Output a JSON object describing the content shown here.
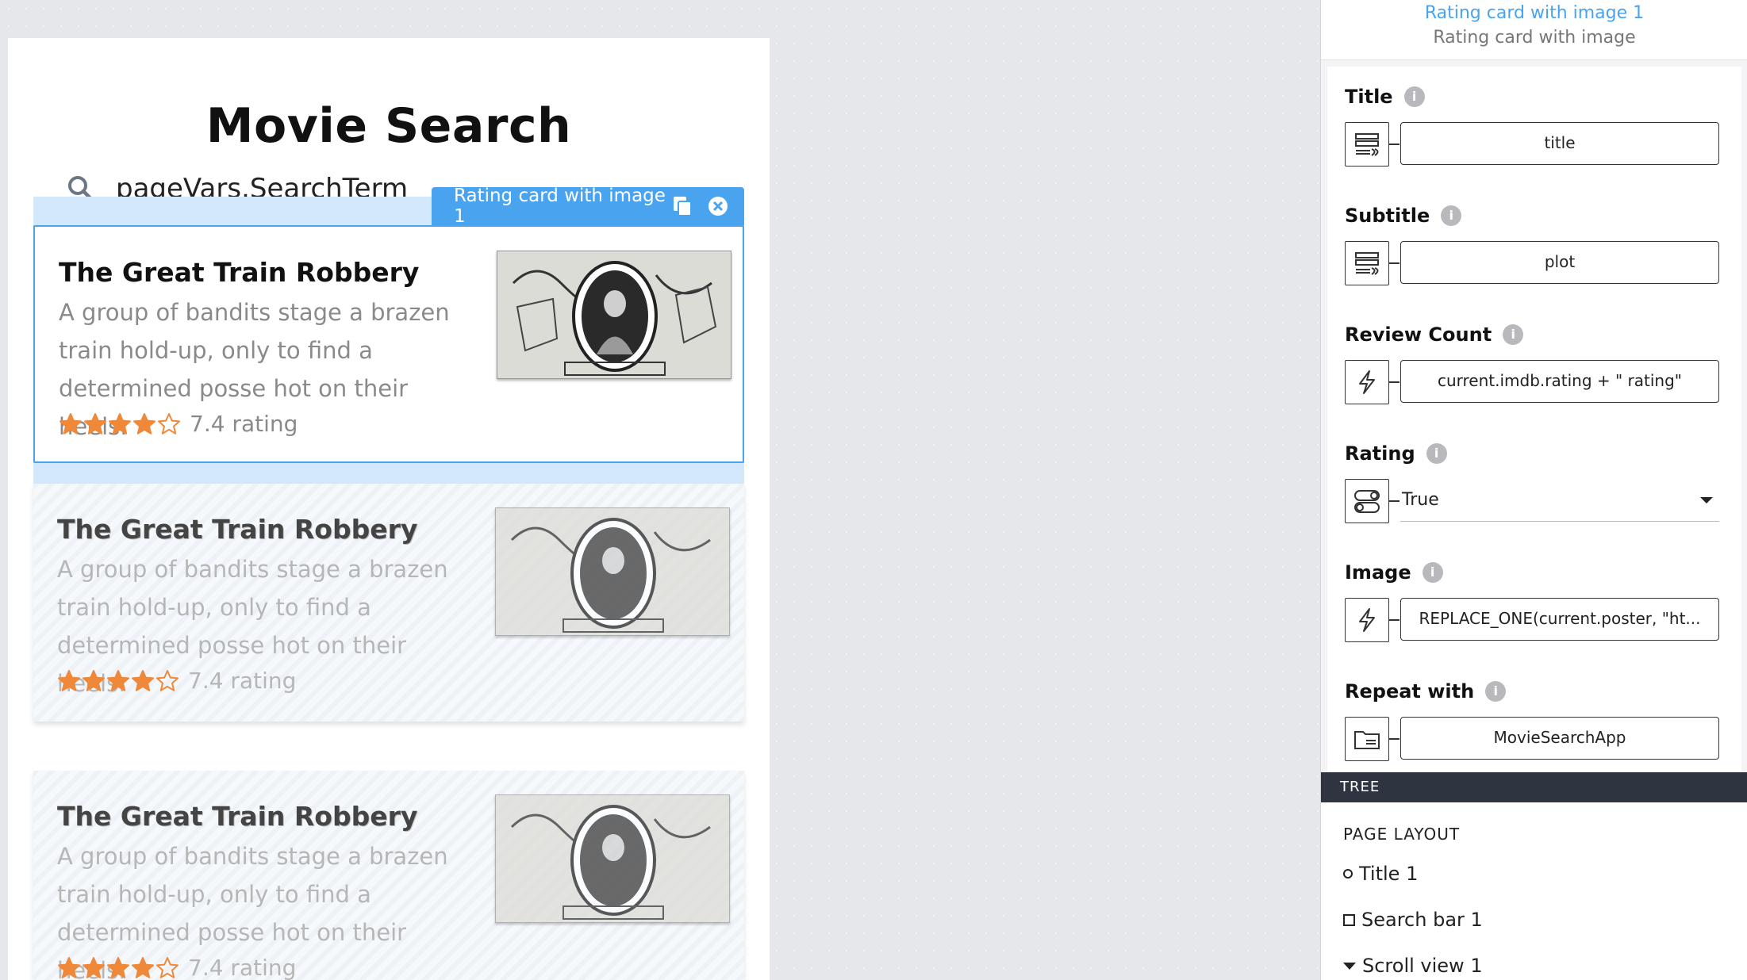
{
  "canvas": {
    "app_title": "Movie Search",
    "search_text": "pageVars.SearchTerm",
    "selection_tag": "Rating card with image 1",
    "cards": [
      {
        "title": "The Great Train Robbery",
        "subtitle_lines": [
          "A group of bandits stage a brazen",
          "train hold-up, only to find a",
          "determined posse hot on their heels."
        ],
        "rating_text": "7.4 rating",
        "stars": 4
      },
      {
        "title": "The Great Train Robbery",
        "subtitle_lines": [
          "A group of bandits stage a brazen",
          "train hold-up, only to find a",
          "determined posse hot on their heels."
        ],
        "rating_text": "7.4 rating",
        "stars": 4
      },
      {
        "title": "The Great Train Robbery",
        "subtitle_lines": [
          "A group of bandits stage a brazen",
          "train hold-up, only to find a",
          "determined posse hot on their heels."
        ],
        "rating_text": "7.4 rating",
        "stars": 4
      }
    ]
  },
  "inspector": {
    "component_name": "Rating card with image 1",
    "component_type": "Rating card with image",
    "props": [
      {
        "label": "Title",
        "type_icon": "text-binding-icon",
        "value": "title"
      },
      {
        "label": "Subtitle",
        "type_icon": "text-binding-icon",
        "value": "plot"
      },
      {
        "label": "Review Count",
        "type_icon": "formula-icon",
        "value": "current.imdb.rating + \" rating\""
      },
      {
        "label": "Rating",
        "type_icon": "toggle-icon",
        "value": "True"
      },
      {
        "label": "Image",
        "type_icon": "formula-icon",
        "value": "REPLACE_ONE(current.poster, \"ht..."
      },
      {
        "label": "Repeat with",
        "type_icon": "collection-icon",
        "value": "MovieSearchApp"
      }
    ],
    "info_glyph": "i"
  },
  "tree": {
    "header": "TREE",
    "section": "PAGE LAYOUT",
    "items": [
      "Title 1",
      "Search bar 1",
      "Scroll view 1"
    ]
  },
  "colors": {
    "accent": "#4aa3ee",
    "star": "#f0883a",
    "tree_header": "#2f3540"
  }
}
